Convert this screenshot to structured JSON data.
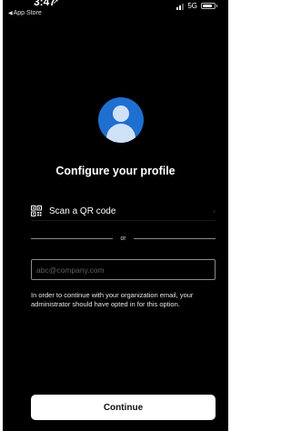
{
  "status_bar": {
    "time": "3:47",
    "back_label": "App Store",
    "back_icon": "back-arrow-icon",
    "network": "5G"
  },
  "avatar_icon": "person-icon",
  "title": "Configure your profile",
  "qr_option": {
    "icon": "qr-code-icon",
    "label": "Scan a QR code",
    "chevron": "›"
  },
  "divider_text": "or",
  "email": {
    "placeholder": "abc@company.com",
    "value": ""
  },
  "help_text": "In order to continue with your organization email, your administrator should have opted in for this option.",
  "continue_label": "Continue",
  "colors": {
    "background": "#000000",
    "avatar": "#1e6fd0",
    "avatar_figure": "#cfe1f7",
    "button_background": "#ffffff"
  }
}
